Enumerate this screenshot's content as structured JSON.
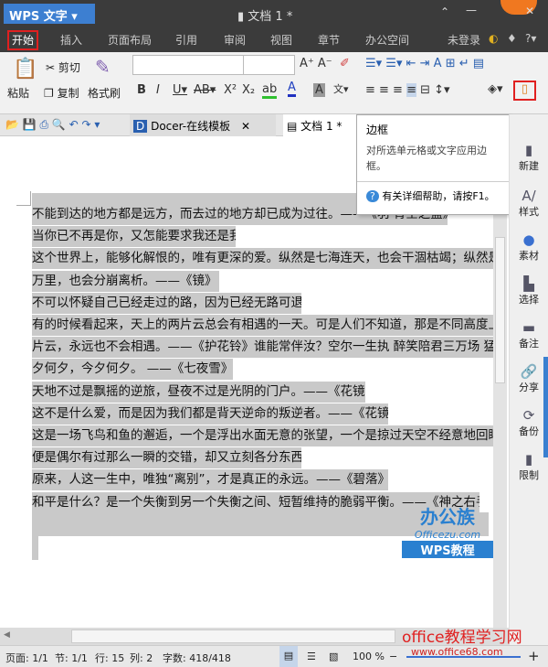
{
  "app": {
    "name": "WPS 文字",
    "doc_title": "文档 1 *"
  },
  "menu": {
    "tabs": [
      "开始",
      "插入",
      "页面布局",
      "引用",
      "审阅",
      "视图",
      "章节",
      "办公空间"
    ],
    "login": "未登录"
  },
  "ribbon": {
    "paste": "粘贴",
    "cut": "剪切",
    "copy": "复制",
    "format_painter": "格式刷",
    "font_name": "",
    "font_size": ""
  },
  "doc_tabs": [
    {
      "label": "Docer-在线模板"
    },
    {
      "label": "文档 1 *"
    }
  ],
  "tooltip": {
    "title": "边框",
    "desc": "对所选单元格或文字应用边框。",
    "help": "有关详细帮助，请按F1。"
  },
  "sidebar": [
    "新建",
    "样式",
    "素材",
    "选择",
    "备注",
    "分享",
    "备份",
    "限制"
  ],
  "lines": [
    "不能到达的地方都是远方，而去过的地方却已成为过往。——《羽·青空之蓝》",
    "当你已不再是你，又怎能要求我还是我呢。",
    "这个世界上，能够化解恨的，唯有更深的爱。纵然是七海连天，也会干涸枯竭；纵然是云",
    "万里，也会分崩离析。——《镜》",
    "不可以怀疑自己已经走过的路，因为已经无路可退。",
    "有的时候看起来，天上的两片云总会有相遇的一天。可是人们不知道，那是不同高度上的",
    "片云，永远也不会相遇。——《护花铃》谁能常伴汝？空尔一生执 醉笑陪君三万场 猛悟",
    "夕何夕，今夕何夕。 ——《七夜雪》",
    "天地不过是飘摇的逆旅，昼夜不过是光阴的门户。——《花镜》",
    "这不是什么爱，而是因为我们都是背天逆命的叛逆者。——《花镜》",
    "这是一场飞鸟和鱼的邂逅，一个是浮出水面无意的张望，一个是掠过天空不经意地回眸。 F",
    "便是偶尔有过那么一瞬的交错，却又立刻各分东西。",
    "原来，人这一生中，唯独“离别”，才是真正的永远。——《碧落》",
    "和平是什么？是一个失衡到另一个失衡之间、短暂维持的脆弱平衡。——《神之右手》"
  ],
  "watermark": {
    "top": "办公族",
    "mid": "Officezu.com",
    "bottom": "WPS教程",
    "site": "office教程学习网",
    "url": "www.office68.com"
  },
  "status": {
    "page": "页面: 1/1",
    "section": "节: 1/1",
    "row": "行: 15",
    "col": "列: 2",
    "words": "字数: 418/418",
    "zoom": "100 %"
  }
}
